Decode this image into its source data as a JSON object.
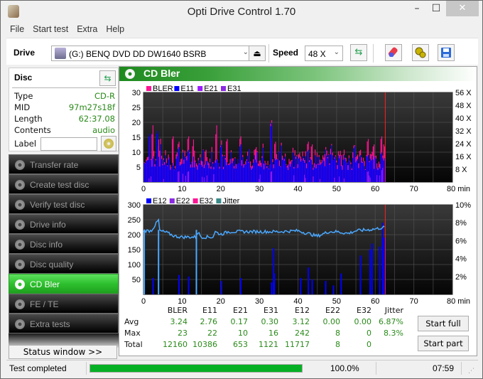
{
  "window": {
    "title": "Opti Drive Control 1.70",
    "controls": {
      "minimize": "–",
      "maximize": "☐",
      "close": "✕"
    }
  },
  "menu": [
    "File",
    "Start test",
    "Extra",
    "Help"
  ],
  "toolbar": {
    "drive_label": "Drive",
    "drive_value": "(G:)  BENQ DVD DD DW1640 BSRB",
    "speed_label": "Speed",
    "speed_value": "48 X",
    "icons": [
      "eject-icon",
      "refresh-icon",
      "erase-icon",
      "settings-icon",
      "save-icon"
    ]
  },
  "disc": {
    "heading": "Disc",
    "rows": [
      {
        "key": "Type",
        "value": "CD-R"
      },
      {
        "key": "MID",
        "value": "97m27s18f"
      },
      {
        "key": "Length",
        "value": "62:37.08"
      },
      {
        "key": "Contents",
        "value": "audio"
      }
    ],
    "label_key": "Label",
    "label_value": ""
  },
  "nav": [
    {
      "label": "Transfer rate",
      "active": false
    },
    {
      "label": "Create test disc",
      "active": false
    },
    {
      "label": "Verify test disc",
      "active": false
    },
    {
      "label": "Drive info",
      "active": false
    },
    {
      "label": "Disc info",
      "active": false
    },
    {
      "label": "Disc quality",
      "active": false
    },
    {
      "label": "CD Bler",
      "active": true
    },
    {
      "label": "FE / TE",
      "active": false
    },
    {
      "label": "Extra tests",
      "active": false
    }
  ],
  "status_window_button": "Status window >>",
  "main": {
    "title": "CD Bler"
  },
  "colors": {
    "bler": "#ff1493",
    "e11": "#0000ff",
    "e21": "#9b1cff",
    "e31": "#8a2be2",
    "e12": "#0000ff",
    "e22": "#8a2be2",
    "e32": "#ff1493",
    "jitter": "#3a8a8a",
    "jitter_line": "#4aa8ff",
    "position_marker": "#ff2020",
    "active_nav": "#2ec02e",
    "progress": "#06b025"
  },
  "chart_data": [
    {
      "type": "bar",
      "title": "CD Bler (top)",
      "legend": [
        "BLER",
        "E11",
        "E21",
        "E31"
      ],
      "legend_position": "top-left",
      "xlabel": "min",
      "x_ticks": [
        "0",
        "10",
        "20",
        "30",
        "40",
        "50",
        "60",
        "70",
        "80 min"
      ],
      "xlim": [
        0,
        80
      ],
      "y_ticks": [
        "5",
        "10",
        "15",
        "20",
        "25",
        "30"
      ],
      "ylim": [
        0,
        30
      ],
      "y2_ticks": [
        "8 X",
        "16 X",
        "24 X",
        "32 X",
        "40 X",
        "48 X",
        "56 X"
      ],
      "y2lim": [
        0,
        56
      ],
      "grid": true,
      "end_marker_min": 62.6,
      "series": [
        {
          "name": "BLER",
          "peaks": [
            [
              1.5,
              17
            ],
            [
              2.3,
              20
            ],
            [
              3.8,
              15
            ],
            [
              7.5,
              17
            ],
            [
              9,
              15
            ],
            [
              11.5,
              17
            ],
            [
              12.8,
              15
            ],
            [
              16,
              12
            ],
            [
              18.8,
              20
            ],
            [
              21.5,
              16
            ],
            [
              25,
              17
            ],
            [
              29,
              13
            ],
            [
              33,
              23
            ],
            [
              34,
              15
            ],
            [
              42.5,
              15
            ],
            [
              43.5,
              14
            ],
            [
              47,
              11
            ],
            [
              48.5,
              10
            ],
            [
              51,
              10
            ],
            [
              56,
              12
            ],
            [
              58,
              16
            ],
            [
              59.5,
              14
            ],
            [
              61.5,
              17
            ],
            [
              62.2,
              14
            ]
          ],
          "baseline": 6
        },
        {
          "name": "E11",
          "peaks": [
            [
              1.5,
              18
            ],
            [
              3.5,
              19
            ],
            [
              9,
              13
            ],
            [
              11.5,
              12
            ],
            [
              18.8,
              8
            ],
            [
              25,
              14
            ],
            [
              33,
              22
            ],
            [
              42.5,
              12
            ],
            [
              56,
              10
            ],
            [
              58,
              10
            ],
            [
              61.5,
              11
            ]
          ],
          "baseline": 5
        },
        {
          "name": "E21",
          "peaks": [
            [
              9,
              4
            ],
            [
              11.5,
              4
            ],
            [
              33,
              4
            ],
            [
              58,
              4
            ],
            [
              61.8,
              5
            ]
          ],
          "baseline": 0
        },
        {
          "name": "E31",
          "peaks": [
            [
              58,
              3
            ],
            [
              61.8,
              4
            ]
          ],
          "baseline": 0
        }
      ]
    },
    {
      "type": "bar",
      "title": "CD Bler (bottom)",
      "legend": [
        "E12",
        "E22",
        "E32",
        "Jitter"
      ],
      "legend_position": "top-left",
      "xlabel": "min",
      "x_ticks": [
        "0",
        "10",
        "20",
        "30",
        "40",
        "50",
        "60",
        "70",
        "80 min"
      ],
      "xlim": [
        0,
        80
      ],
      "y_ticks": [
        "50",
        "100",
        "150",
        "200",
        "250",
        "300"
      ],
      "ylim": [
        0,
        300
      ],
      "y2_ticks": [
        "2%",
        "4%",
        "6%",
        "8%",
        "10%"
      ],
      "y2lim": [
        0,
        10
      ],
      "grid": true,
      "end_marker_min": 62.6,
      "series": [
        {
          "name": "E12",
          "peaks": [
            [
              2.3,
              55
            ],
            [
              9,
              65
            ],
            [
              11.5,
              60
            ],
            [
              20,
              45
            ],
            [
              25,
              55
            ],
            [
              33,
              40
            ],
            [
              33.5,
              155
            ],
            [
              33.7,
              70
            ],
            [
              40.5,
              55
            ],
            [
              42.5,
              90
            ],
            [
              43.5,
              50
            ],
            [
              47,
              45
            ],
            [
              49,
              30
            ],
            [
              51,
              70
            ],
            [
              56,
              130
            ],
            [
              58.5,
              150
            ],
            [
              59,
              170
            ],
            [
              61,
              160
            ],
            [
              61.7,
              240
            ],
            [
              62.1,
              190
            ]
          ]
        },
        {
          "name": "E22",
          "peaks": []
        },
        {
          "name": "E32",
          "peaks": []
        },
        {
          "name": "Jitter",
          "unit": "%",
          "points": [
            [
              0,
              7.1
            ],
            [
              2,
              7.1
            ],
            [
              3.9,
              8.3
            ],
            [
              4.2,
              7.1
            ],
            [
              6,
              6.9
            ],
            [
              8,
              6.5
            ],
            [
              10,
              6.4
            ],
            [
              12,
              6.4
            ],
            [
              13.5,
              6.4
            ],
            [
              14,
              7.0
            ],
            [
              15,
              6.4
            ],
            [
              18,
              6.4
            ],
            [
              18.5,
              7.0
            ],
            [
              20,
              6.7
            ],
            [
              22,
              7.0
            ],
            [
              25,
              7.0
            ],
            [
              30,
              7.0
            ],
            [
              35,
              7.0
            ],
            [
              40,
              7.1
            ],
            [
              45,
              6.5
            ],
            [
              48,
              7.0
            ],
            [
              50,
              7.0
            ],
            [
              53,
              6.8
            ],
            [
              55,
              7.1
            ],
            [
              58,
              7.2
            ],
            [
              60,
              7.3
            ],
            [
              62.6,
              7.5
            ]
          ],
          "dips": [
            [
              0.2,
              0
            ],
            [
              3.9,
              0
            ],
            [
              13.7,
              0
            ]
          ]
        }
      ]
    }
  ],
  "stats": {
    "columns": [
      "BLER",
      "E11",
      "E21",
      "E31",
      "E12",
      "E22",
      "E32",
      "Jitter"
    ],
    "rows": [
      {
        "label": "Avg",
        "values": [
          "3.24",
          "2.76",
          "0.17",
          "0.30",
          "3.12",
          "0.00",
          "0.00",
          "6.87%"
        ]
      },
      {
        "label": "Max",
        "values": [
          "23",
          "22",
          "10",
          "16",
          "242",
          "8",
          "0",
          "8.3%"
        ]
      },
      {
        "label": "Total",
        "values": [
          "12160",
          "10386",
          "653",
          "1121",
          "11717",
          "8",
          "0",
          ""
        ]
      }
    ]
  },
  "buttons": {
    "start_full": "Start full",
    "start_part": "Start part"
  },
  "statusbar": {
    "text": "Test completed",
    "progress_percent": 100,
    "progress_label": "100.0%",
    "elapsed": "07:59"
  }
}
